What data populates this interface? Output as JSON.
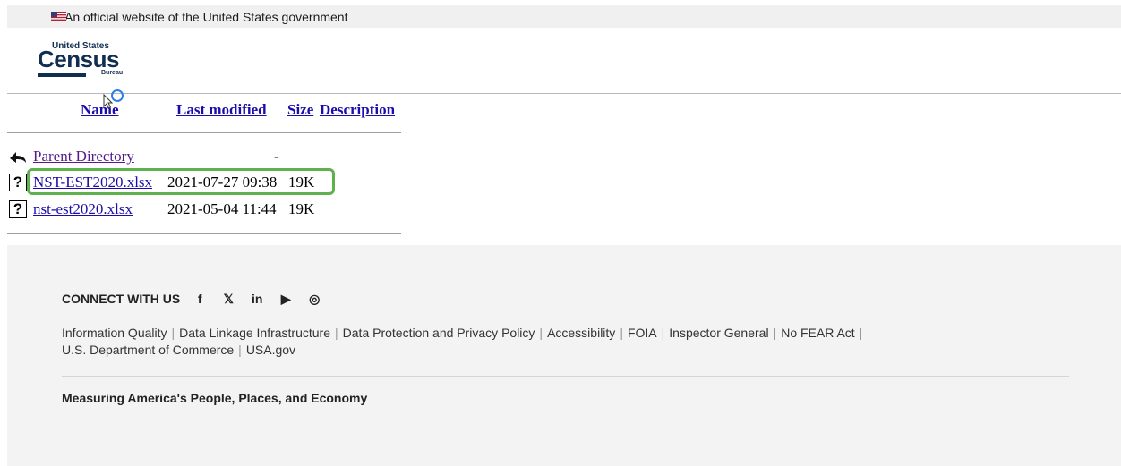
{
  "gov_banner": {
    "text": "An official website of the United States government"
  },
  "logo": {
    "small": "United States",
    "big": "Census",
    "bureau": "Bureau"
  },
  "table": {
    "headers": {
      "name": "Name",
      "last_modified": "Last modified",
      "size": "Size",
      "description": "Description"
    },
    "rows": [
      {
        "name": "Parent Directory",
        "modified": "",
        "size": "-",
        "icon": "back-arrow-icon"
      },
      {
        "name": "NST-EST2020.xlsx",
        "modified": "2021-07-27 09:38",
        "size": "19K",
        "icon": "unknown-file-icon"
      },
      {
        "name": "nst-est2020.xlsx",
        "modified": "2021-05-04 11:44",
        "size": "19K",
        "icon": "unknown-file-icon"
      }
    ]
  },
  "footer": {
    "connect_label": "CONNECT WITH US",
    "social": {
      "facebook": "f",
      "x": "𝕏",
      "linkedin": "in",
      "youtube": "▶",
      "instagram": "◎"
    },
    "links": [
      "Information Quality",
      "Data Linkage Infrastructure",
      "Data Protection and Privacy Policy",
      "Accessibility",
      "FOIA",
      "Inspector General",
      "No FEAR Act",
      "U.S. Department of Commerce",
      "USA.gov"
    ],
    "tagline": "Measuring America's People, Places, and Economy"
  },
  "colors": {
    "link": "#1a0dab",
    "visited": "#551a8b",
    "highlight": "#5fb14d",
    "footer_bg": "#f3f3f3"
  }
}
